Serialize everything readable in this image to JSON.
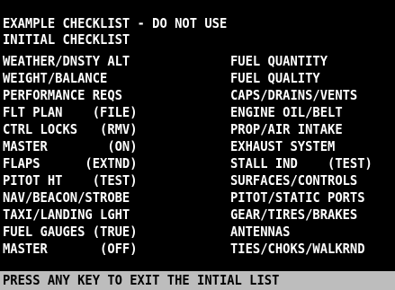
{
  "header": {
    "title": "EXAMPLE CHECKLIST - DO NOT USE",
    "subtitle": "INITIAL CHECKLIST"
  },
  "left_column": [
    "WEATHER/DNSTY ALT",
    "WEIGHT/BALANCE",
    "PERFORMANCE REQS",
    "FLT PLAN    (FILE)",
    "CTRL LOCKS   (RMV)",
    "MASTER        (ON)",
    "FLAPS      (EXTND)",
    "PITOT HT    (TEST)",
    "NAV/BEACON/STROBE",
    "TAXI/LANDING LGHT",
    "FUEL GAUGES (TRUE)",
    "MASTER       (OFF)"
  ],
  "right_column": [
    "FUEL QUANTITY",
    "FUEL QUALITY",
    "CAPS/DRAINS/VENTS",
    "ENGINE OIL/BELT",
    "PROP/AIR INTAKE",
    "EXHAUST SYSTEM",
    "STALL IND    (TEST)",
    "SURFACES/CONTROLS",
    "PITOT/STATIC PORTS",
    "GEAR/TIRES/BRAKES",
    "ANTENNAS",
    "TIES/CHOKS/WALKRND"
  ],
  "status": {
    "prompt": "PRESS ANY KEY TO EXIT THE INTIAL LIST"
  }
}
